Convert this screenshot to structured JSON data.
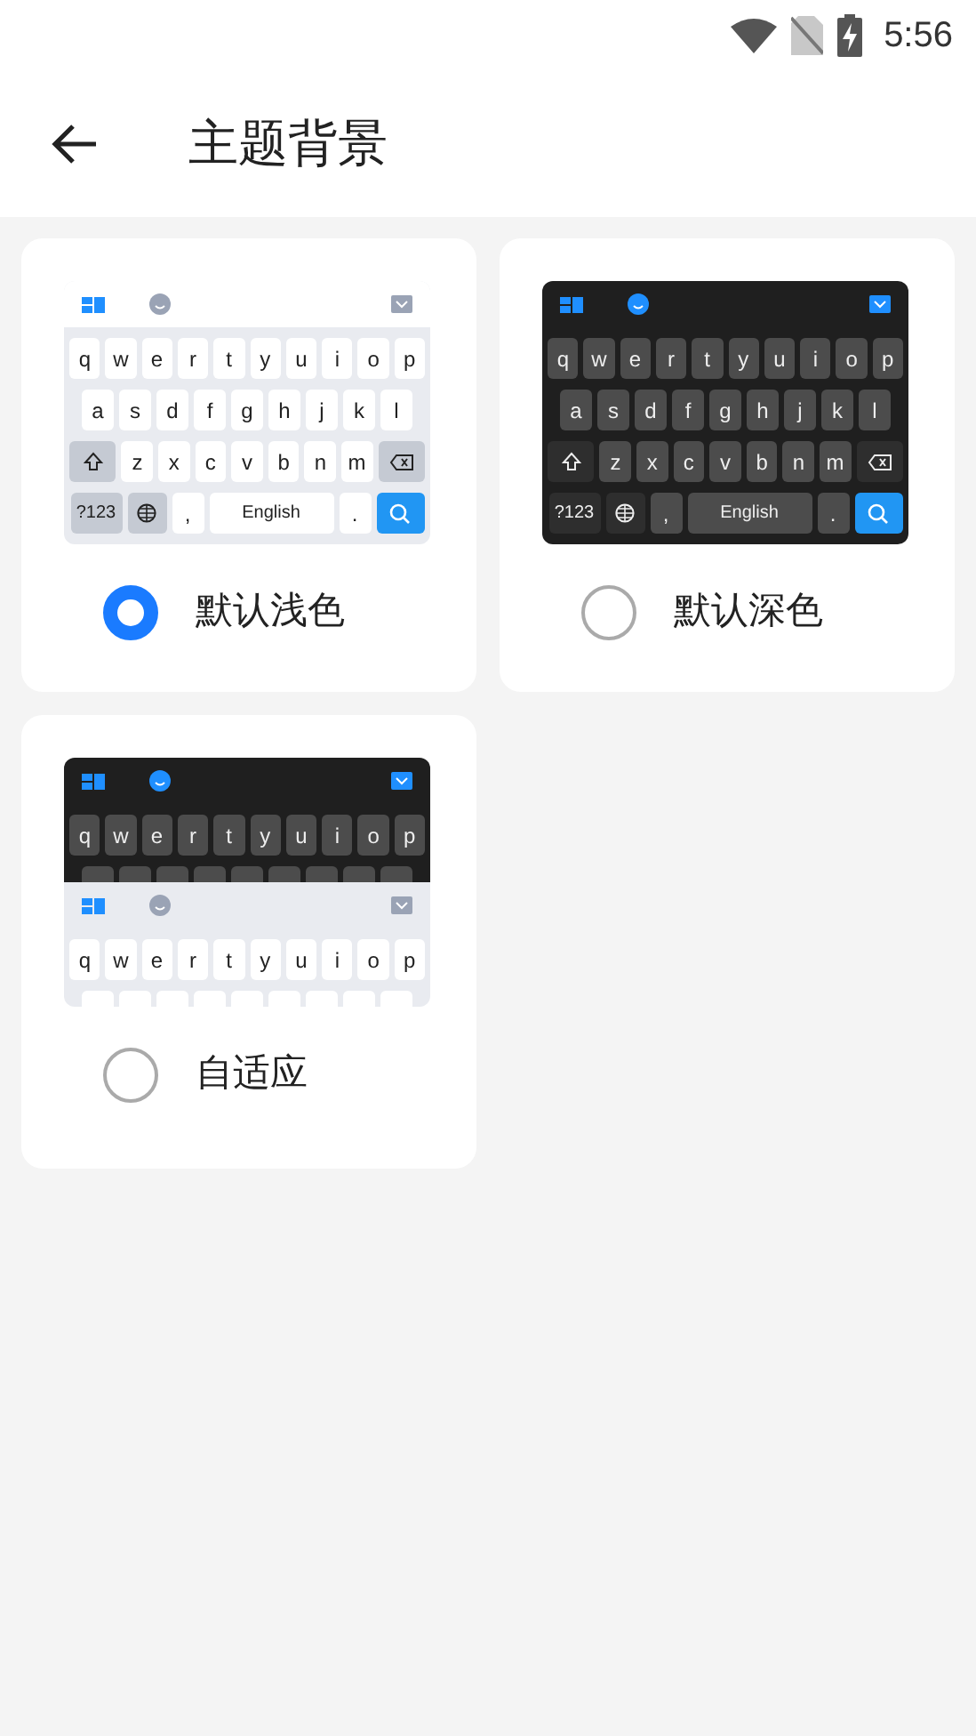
{
  "status_bar": {
    "time": "5:56"
  },
  "header": {
    "title": "主题背景"
  },
  "themes": [
    {
      "label": "默认浅色",
      "selected": true,
      "preview": {
        "kind": "full",
        "dark": false,
        "rows": [
          [
            "q",
            "w",
            "e",
            "r",
            "t",
            "y",
            "u",
            "i",
            "o",
            "p"
          ],
          [
            "a",
            "s",
            "d",
            "f",
            "g",
            "h",
            "j",
            "k",
            "l"
          ],
          [
            "z",
            "x",
            "c",
            "v",
            "b",
            "n",
            "m"
          ]
        ],
        "numbers_key": "?123",
        "comma_key": ",",
        "space_key": "English",
        "period_key": "."
      }
    },
    {
      "label": "默认深色",
      "selected": false,
      "preview": {
        "kind": "full",
        "dark": true,
        "rows": [
          [
            "q",
            "w",
            "e",
            "r",
            "t",
            "y",
            "u",
            "i",
            "o",
            "p"
          ],
          [
            "a",
            "s",
            "d",
            "f",
            "g",
            "h",
            "j",
            "k",
            "l"
          ],
          [
            "z",
            "x",
            "c",
            "v",
            "b",
            "n",
            "m"
          ]
        ],
        "numbers_key": "?123",
        "comma_key": ",",
        "space_key": "English",
        "period_key": "."
      }
    },
    {
      "label": "自适应",
      "selected": false,
      "preview": {
        "kind": "split",
        "parts": [
          {
            "dark": true,
            "rows": [
              [
                "q",
                "w",
                "e",
                "r",
                "t",
                "y",
                "u",
                "i",
                "o",
                "p"
              ]
            ]
          },
          {
            "dark": false,
            "rows": [
              [
                "q",
                "w",
                "e",
                "r",
                "t",
                "y",
                "u",
                "i",
                "o",
                "p"
              ]
            ]
          }
        ]
      }
    }
  ]
}
